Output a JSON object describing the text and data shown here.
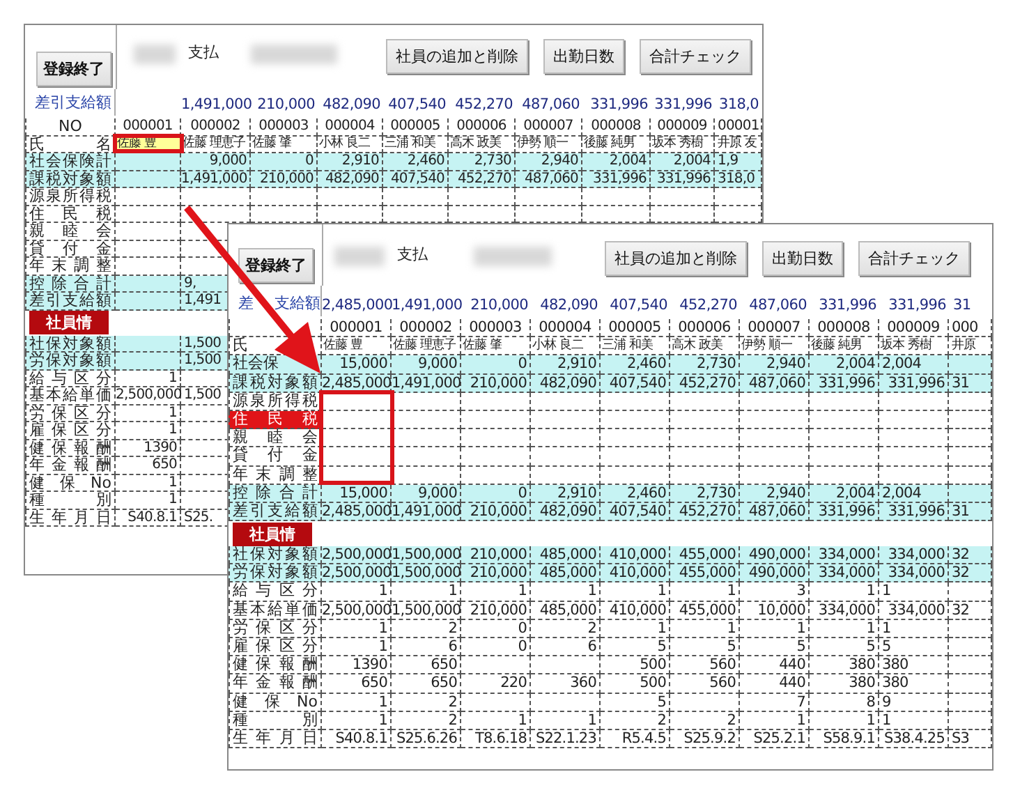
{
  "windows": [
    {
      "buttons": [
        {
          "label": "登録終了"
        },
        {
          "label": "社員の追加と削除"
        },
        {
          "label": "出勤日数"
        },
        {
          "label": "合計チェック"
        }
      ],
      "payee": "支払",
      "summary": {
        "label": "差引支給額",
        "values": [
          "1,491,000",
          "210,000",
          "482,090",
          "407,540",
          "452,270",
          "487,060",
          "331,996",
          "331,996",
          "318,0"
        ]
      },
      "rows": [
        {
          "kind": "id",
          "label": "NO",
          "shaded": false,
          "highlighted": false,
          "cells": [
            "000001",
            "000002",
            "000003",
            "000004",
            "000005",
            "000006",
            "000007",
            "000008",
            "000009",
            "00001"
          ]
        },
        {
          "kind": "name",
          "label": "氏名",
          "shaded": false,
          "highlighted": false,
          "cells": [
            {
              "text": "佐藤 豊",
              "selected": true
            },
            {
              "text": "佐藤 理恵子",
              "selected": false
            },
            {
              "text": "佐藤 肇",
              "selected": false
            },
            {
              "text": "小林 良二",
              "selected": false
            },
            {
              "text": "三浦 和美",
              "selected": false
            },
            {
              "text": "高木 政美",
              "selected": false
            },
            {
              "text": "伊勢 順一",
              "selected": false
            },
            {
              "text": "後藤 純男",
              "selected": false
            },
            {
              "text": "坂本 秀樹",
              "selected": false
            },
            {
              "text": "井原 友",
              "selected": false
            }
          ]
        },
        {
          "kind": "data",
          "label": "社会保険計",
          "shaded": true,
          "highlighted": false,
          "cells": [
            null,
            "9,000",
            "0",
            "2,910",
            "2,460",
            "2,730",
            "2,940",
            "2,004",
            "2,004",
            "1,9"
          ]
        },
        {
          "kind": "data",
          "label": "課税対象額",
          "shaded": true,
          "highlighted": false,
          "cells": [
            null,
            "1,491,000",
            "210,000",
            "482,090",
            "407,540",
            "452,270",
            "487,060",
            "331,996",
            "331,996",
            "318,0"
          ]
        },
        {
          "kind": "data",
          "label": "源泉所得税",
          "shaded": false,
          "highlighted": false,
          "cells": []
        },
        {
          "kind": "data",
          "label": "住民税",
          "shaded": false,
          "highlighted": false,
          "cells": []
        },
        {
          "kind": "data",
          "label": "親睦会",
          "shaded": false,
          "highlighted": false,
          "cells": []
        },
        {
          "kind": "data",
          "label": "貸付金",
          "shaded": false,
          "highlighted": false,
          "cells": []
        },
        {
          "kind": "data",
          "label": "年末調整",
          "shaded": false,
          "highlighted": false,
          "cells": []
        },
        {
          "kind": "data",
          "label": "控除合計",
          "shaded": true,
          "highlighted": false,
          "cells": [
            null,
            "9,"
          ]
        },
        {
          "kind": "data",
          "label": "差引支給額",
          "shaded": true,
          "highlighted": false,
          "cells": [
            null,
            "1,491"
          ]
        },
        {
          "kind": "section",
          "label": "社員情"
        },
        {
          "kind": "data",
          "label": "社保対象額",
          "shaded": true,
          "highlighted": false,
          "cells": [
            null,
            "1,500"
          ]
        },
        {
          "kind": "data",
          "label": "労保対象額",
          "shaded": true,
          "highlighted": false,
          "cells": [
            null,
            "1,500"
          ]
        },
        {
          "kind": "data",
          "label": "給与区分",
          "shaded": false,
          "highlighted": false,
          "cells": [
            "1"
          ]
        },
        {
          "kind": "data",
          "label": "基本給単価",
          "shaded": false,
          "highlighted": false,
          "cells": [
            "2,500,000",
            "1,500"
          ]
        },
        {
          "kind": "data",
          "label": "労保区分",
          "shaded": false,
          "highlighted": false,
          "cells": [
            "1"
          ]
        },
        {
          "kind": "data",
          "label": "雇保区分",
          "shaded": false,
          "highlighted": false,
          "cells": [
            "1"
          ]
        },
        {
          "kind": "data",
          "label": "健保報酬",
          "shaded": false,
          "highlighted": false,
          "cells": [
            "1390"
          ]
        },
        {
          "kind": "data",
          "label": "年金報酬",
          "shaded": false,
          "highlighted": false,
          "cells": [
            "650"
          ]
        },
        {
          "kind": "data",
          "label": "健保No",
          "shaded": false,
          "highlighted": false,
          "cells": [
            "1"
          ]
        },
        {
          "kind": "data",
          "label": "種別",
          "shaded": false,
          "highlighted": false,
          "cells": [
            "1"
          ]
        },
        {
          "kind": "data",
          "label": "生年月日",
          "shaded": false,
          "highlighted": false,
          "cells": [
            "S40.8.1",
            "S25."
          ]
        }
      ]
    },
    {
      "buttons": [
        {
          "label": "登録終了"
        },
        {
          "label": "社員の追加と削除"
        },
        {
          "label": "出勤日数"
        },
        {
          "label": "合計チェック"
        }
      ],
      "payee": "支払",
      "summary": {
        "label_parts": [
          "差",
          "支給額"
        ],
        "values": [
          "2,485,000",
          "1,491,000",
          "210,000",
          "482,090",
          "407,540",
          "452,270",
          "487,060",
          "331,996",
          "331,996",
          "31"
        ]
      },
      "rows": [
        {
          "kind": "id",
          "shaded": false,
          "highlighted": false,
          "cells": [
            "000001",
            "000002",
            "000003",
            "000004",
            "000005",
            "000006",
            "000007",
            "000008",
            "000009",
            "000"
          ]
        },
        {
          "kind": "name",
          "label": "氏",
          "shaded": false,
          "highlighted": false,
          "cells": [
            "佐藤 豊",
            "佐藤 理恵子",
            "佐藤 肇",
            "小林 良二",
            "三浦 和美",
            "高木 政美",
            "伊勢 順一",
            "後藤 純男",
            "坂本 秀樹",
            "井原"
          ]
        },
        {
          "kind": "data",
          "label": "社会保",
          "covered": true,
          "shaded": true,
          "highlighted": false,
          "cells": [
            "15,000",
            "9,000",
            "0",
            "2,910",
            "2,460",
            "2,730",
            "2,940",
            "2,004",
            "2,004"
          ]
        },
        {
          "kind": "data",
          "label": "課税対象額",
          "shaded": true,
          "highlighted": false,
          "cells": [
            "2,485,000",
            "1,491,000",
            "210,000",
            "482,090",
            "407,540",
            "452,270",
            "487,060",
            "331,996",
            "331,996",
            "31"
          ]
        },
        {
          "kind": "data",
          "label": "源泉所得税",
          "shaded": false,
          "highlighted": false,
          "cells": []
        },
        {
          "kind": "data",
          "label": "住民税",
          "shaded": false,
          "highlighted": true,
          "cells": []
        },
        {
          "kind": "data",
          "label": "親睦会",
          "shaded": false,
          "highlighted": false,
          "cells": []
        },
        {
          "kind": "data",
          "label": "貸付金",
          "shaded": false,
          "highlighted": false,
          "cells": []
        },
        {
          "kind": "data",
          "label": "年末調整",
          "shaded": false,
          "highlighted": false,
          "cells": []
        },
        {
          "kind": "data",
          "label": "控除合計",
          "shaded": true,
          "highlighted": false,
          "cells": [
            "15,000",
            "9,000",
            "0",
            "2,910",
            "2,460",
            "2,730",
            "2,940",
            "2,004",
            "2,004"
          ]
        },
        {
          "kind": "data",
          "label": "差引支給額",
          "shaded": true,
          "highlighted": false,
          "cells": [
            "2,485,000",
            "1,491,000",
            "210,000",
            "482,090",
            "407,540",
            "452,270",
            "487,060",
            "331,996",
            "331,996",
            "31"
          ]
        },
        {
          "kind": "section",
          "label": "社員情"
        },
        {
          "kind": "data",
          "label": "社保対象額",
          "shaded": true,
          "highlighted": false,
          "cells": [
            "2,500,000",
            "1,500,000",
            "210,000",
            "485,000",
            "410,000",
            "455,000",
            "490,000",
            "334,000",
            "334,000",
            "32"
          ]
        },
        {
          "kind": "data",
          "label": "労保対象額",
          "shaded": true,
          "highlighted": false,
          "cells": [
            "2,500,000",
            "1,500,000",
            "210,000",
            "485,000",
            "410,000",
            "455,000",
            "490,000",
            "334,000",
            "334,000",
            "32"
          ]
        },
        {
          "kind": "data",
          "label": "給与区分",
          "shaded": false,
          "highlighted": false,
          "cells": [
            "1",
            "1",
            "1",
            "1",
            "1",
            "1",
            "3",
            "1",
            "1"
          ]
        },
        {
          "kind": "data",
          "label": "基本給単価",
          "shaded": false,
          "highlighted": false,
          "cells": [
            "2,500,000",
            "1,500,000",
            "210,000",
            "485,000",
            "410,000",
            "455,000",
            "10,000",
            "334,000",
            "334,000",
            "32"
          ]
        },
        {
          "kind": "data",
          "label": "労保区分",
          "shaded": false,
          "highlighted": false,
          "cells": [
            "1",
            "2",
            "0",
            "2",
            "1",
            "1",
            "1",
            "1",
            "1"
          ]
        },
        {
          "kind": "data",
          "label": "雇保区分",
          "shaded": false,
          "highlighted": false,
          "cells": [
            "1",
            "6",
            "0",
            "6",
            "5",
            "5",
            "5",
            "5",
            "5"
          ]
        },
        {
          "kind": "data",
          "label": "健保報酬",
          "shaded": false,
          "highlighted": false,
          "cells": [
            "1390",
            "650",
            null,
            null,
            "500",
            "560",
            "440",
            "380",
            "380"
          ]
        },
        {
          "kind": "data",
          "label": "年金報酬",
          "shaded": false,
          "highlighted": false,
          "cells": [
            "650",
            "650",
            "220",
            "360",
            "500",
            "560",
            "440",
            "380",
            "380"
          ]
        },
        {
          "kind": "data",
          "label": "健保No",
          "shaded": false,
          "highlighted": false,
          "cells": [
            "1",
            "2",
            null,
            null,
            "5",
            null,
            "7",
            "8",
            "9"
          ]
        },
        {
          "kind": "data",
          "label": "種別",
          "shaded": false,
          "highlighted": false,
          "cells": [
            "1",
            "2",
            "1",
            "1",
            "2",
            "2",
            "1",
            "1",
            "1"
          ]
        },
        {
          "kind": "data",
          "label": "生年月日",
          "shaded": false,
          "highlighted": false,
          "cells": [
            "S40.8.1",
            "S25.6.26",
            "T8.6.18",
            "S22.1.23",
            "R5.4.5",
            "S25.9.2",
            "S25.2.1",
            "S58.9.1",
            "S38.4.25",
            "S3"
          ]
        }
      ]
    }
  ]
}
